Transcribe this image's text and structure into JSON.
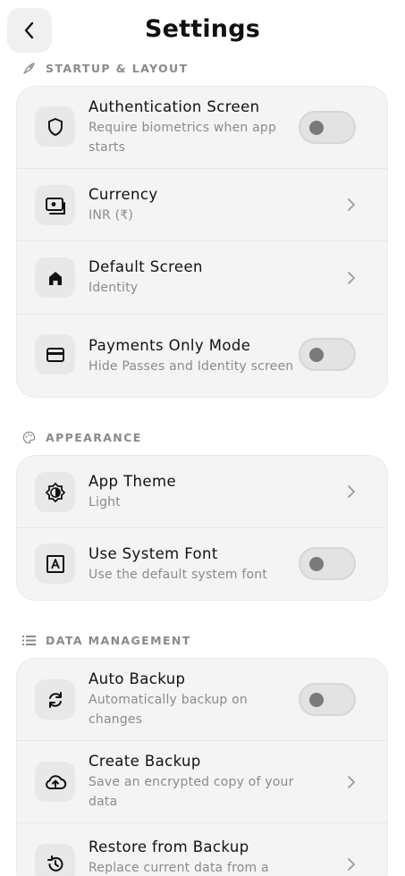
{
  "header": {
    "title": "Settings",
    "back_icon": "chevron-left-icon"
  },
  "sections": [
    {
      "label": "STARTUP & LAYOUT",
      "icon": "rocket-icon",
      "items": [
        {
          "title": "Authentication Screen",
          "subtitle": "Require biometrics when app starts",
          "control": "toggle",
          "enabled": false,
          "icon": "shield-icon"
        },
        {
          "title": "Currency",
          "subtitle": "INR (₹)",
          "control": "chevron",
          "icon": "money-icon"
        },
        {
          "title": "Default Screen",
          "subtitle": "Identity",
          "control": "chevron",
          "icon": "home-icon"
        },
        {
          "title": "Payments Only Mode",
          "subtitle": "Hide Passes and Identity screen",
          "control": "toggle",
          "enabled": false,
          "icon": "credit-card-icon"
        }
      ]
    },
    {
      "label": "APPEARANCE",
      "icon": "palette-icon",
      "items": [
        {
          "title": "App Theme",
          "subtitle": "Light",
          "control": "chevron",
          "icon": "brightness-icon"
        },
        {
          "title": "Use System Font",
          "subtitle": "Use the default system font",
          "control": "toggle",
          "enabled": false,
          "icon": "font-icon"
        }
      ]
    },
    {
      "label": "DATA MANAGEMENT",
      "icon": "list-icon",
      "items": [
        {
          "title": "Auto Backup",
          "subtitle": "Automatically backup on changes",
          "control": "toggle",
          "enabled": false,
          "icon": "sync-icon"
        },
        {
          "title": "Create Backup",
          "subtitle": "Save an encrypted copy of your data",
          "control": "chevron",
          "icon": "cloud-upload-icon"
        },
        {
          "title": "Restore from Backup",
          "subtitle": "Replace current data from a",
          "control": "chevron",
          "icon": "restore-icon"
        }
      ]
    }
  ],
  "colors": {
    "card": "#f4f4f4",
    "muted_text": "#8b8b8b",
    "toggle_off": "#e3e3e3"
  }
}
